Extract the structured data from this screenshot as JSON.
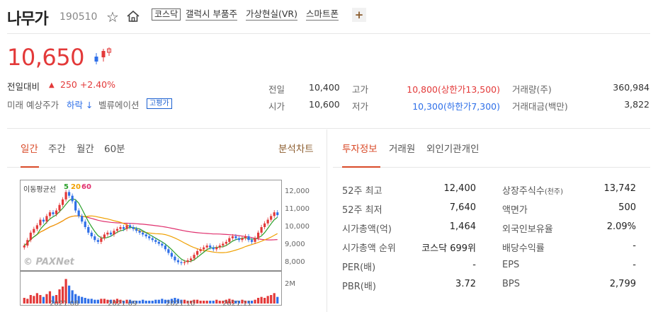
{
  "header": {
    "name": "나무가",
    "code": "190510",
    "market_tag": "코스닥",
    "theme_tags": [
      "갤럭시 부품주",
      "가상현실(VR)",
      "스마트폰"
    ],
    "add_label": "+"
  },
  "quote": {
    "price": "10,650",
    "change_label": "전일대비",
    "change_arrow": "▲",
    "change": "250 +2.40%",
    "forecast_label": "미래 예상주가",
    "forecast_value": "하락 ↓",
    "valuation_label": "벨류에이션",
    "valuation_badge": "고평가"
  },
  "summary": {
    "prev_label": "전일",
    "prev": "10,400",
    "open_label": "시가",
    "open": "10,600",
    "high_label": "고가",
    "high": "10,800(상한가13,500)",
    "low_label": "저가",
    "low": "10,300(하한가7,300)",
    "volume_label": "거래량(주)",
    "volume": "360,984",
    "amount_label": "거래대금(백만)",
    "amount": "3,822"
  },
  "chart_tabs": [
    "일간",
    "주간",
    "월간",
    "60분"
  ],
  "chart_link": "분석차트",
  "info_tabs": [
    "투자정보",
    "거래원",
    "외인기관개인"
  ],
  "chart": {
    "ma_label": "이동평균선",
    "ma_5": "5",
    "ma_20": "20",
    "ma_60": "60",
    "watermark": "© PAXNet",
    "y_ticks": [
      "12,000",
      "11,000",
      "10,000",
      "9,000",
      "8,000"
    ],
    "vol_tick": "2M",
    "x_ticks": [
      "2021.08",
      "2021.09",
      "2021.10",
      "2021.11"
    ]
  },
  "chart_data": {
    "type": "line",
    "ylim": [
      7700,
      12300
    ],
    "x": [
      1,
      2,
      3,
      4,
      5,
      6,
      7,
      8,
      9,
      10,
      11,
      12,
      13,
      14,
      15,
      16,
      17,
      18,
      19,
      20,
      21,
      22,
      23,
      24,
      25,
      26,
      27,
      28,
      29,
      30,
      31,
      32,
      33,
      34,
      35,
      36,
      37,
      38,
      39,
      40,
      41,
      42,
      43,
      44,
      45,
      46,
      47,
      48,
      49,
      50,
      51,
      52,
      53,
      54,
      55,
      56,
      57,
      58,
      59,
      60,
      61,
      62,
      63,
      64,
      65,
      66,
      67,
      68,
      69,
      70,
      71,
      72,
      73,
      74,
      75,
      76,
      77,
      78,
      79,
      80
    ],
    "close": [
      9000,
      9300,
      9700,
      9900,
      10100,
      10400,
      10300,
      10600,
      10800,
      10700,
      10900,
      11200,
      11500,
      11900,
      11700,
      11400,
      10900,
      10600,
      10300,
      10000,
      9700,
      9500,
      9300,
      9200,
      9400,
      9600,
      9700,
      9600,
      9800,
      9900,
      10000,
      9900,
      10100,
      10000,
      9900,
      9800,
      9700,
      9600,
      9500,
      9400,
      9300,
      9200,
      9100,
      9000,
      8800,
      8600,
      8400,
      8200,
      8100,
      8050,
      8100,
      8200,
      8300,
      8500,
      8700,
      8800,
      8900,
      9000,
      8900,
      8800,
      8900,
      9000,
      9100,
      9200,
      9400,
      9500,
      9400,
      9300,
      9400,
      9500,
      9300,
      9200,
      9400,
      9700,
      10000,
      10200,
      10400,
      10600,
      10800,
      10650
    ],
    "volume": [
      0.6,
      0.5,
      0.9,
      0.8,
      1.1,
      0.9,
      0.7,
      1.0,
      1.3,
      0.8,
      0.9,
      1.5,
      1.8,
      2.6,
      1.9,
      1.4,
      1.0,
      0.8,
      0.7,
      0.6,
      0.5,
      0.5,
      0.4,
      0.4,
      0.5,
      0.5,
      0.4,
      0.4,
      0.4,
      0.5,
      0.4,
      0.3,
      0.4,
      0.4,
      0.3,
      0.3,
      0.3,
      0.4,
      0.3,
      0.3,
      0.3,
      0.4,
      0.4,
      0.5,
      0.4,
      0.4,
      0.5,
      0.6,
      0.5,
      0.4,
      0.4,
      0.3,
      0.3,
      0.4,
      0.4,
      0.3,
      0.3,
      0.3,
      0.3,
      0.3,
      0.4,
      0.3,
      0.3,
      0.4,
      0.5,
      0.4,
      0.3,
      0.3,
      0.4,
      0.3,
      0.3,
      0.3,
      0.4,
      0.6,
      0.7,
      0.6,
      0.8,
      0.9,
      1.1,
      0.7
    ],
    "vol_max": 3.0,
    "colors": {
      "up": "#e33939",
      "down": "#2e6fe8",
      "ma5": "#2aa02a",
      "ma20": "#f0a000",
      "ma60": "#e0306e"
    }
  },
  "invest": {
    "left": [
      {
        "label": "52주 최고",
        "value": "12,400"
      },
      {
        "label": "52주 최저",
        "value": "7,640"
      },
      {
        "label": "시가총액(억)",
        "value": "1,464"
      },
      {
        "label": "시가총액 순위",
        "value": "코스닥 699위"
      },
      {
        "label": "PER(배)",
        "value": "-"
      },
      {
        "label": "PBR(배)",
        "value": "3.72"
      }
    ],
    "right": [
      {
        "label": "상장주식수",
        "label_unit": "(천주)",
        "value": "13,742"
      },
      {
        "label": "액면가",
        "label_unit": "",
        "value": "500"
      },
      {
        "label": "외국인보유율",
        "label_unit": "",
        "value": "2.09%"
      },
      {
        "label": "배당수익률",
        "label_unit": "",
        "value": "-"
      },
      {
        "label": "EPS",
        "label_unit": "",
        "value": "-"
      },
      {
        "label": "BPS",
        "label_unit": "",
        "value": "2,799"
      }
    ]
  }
}
